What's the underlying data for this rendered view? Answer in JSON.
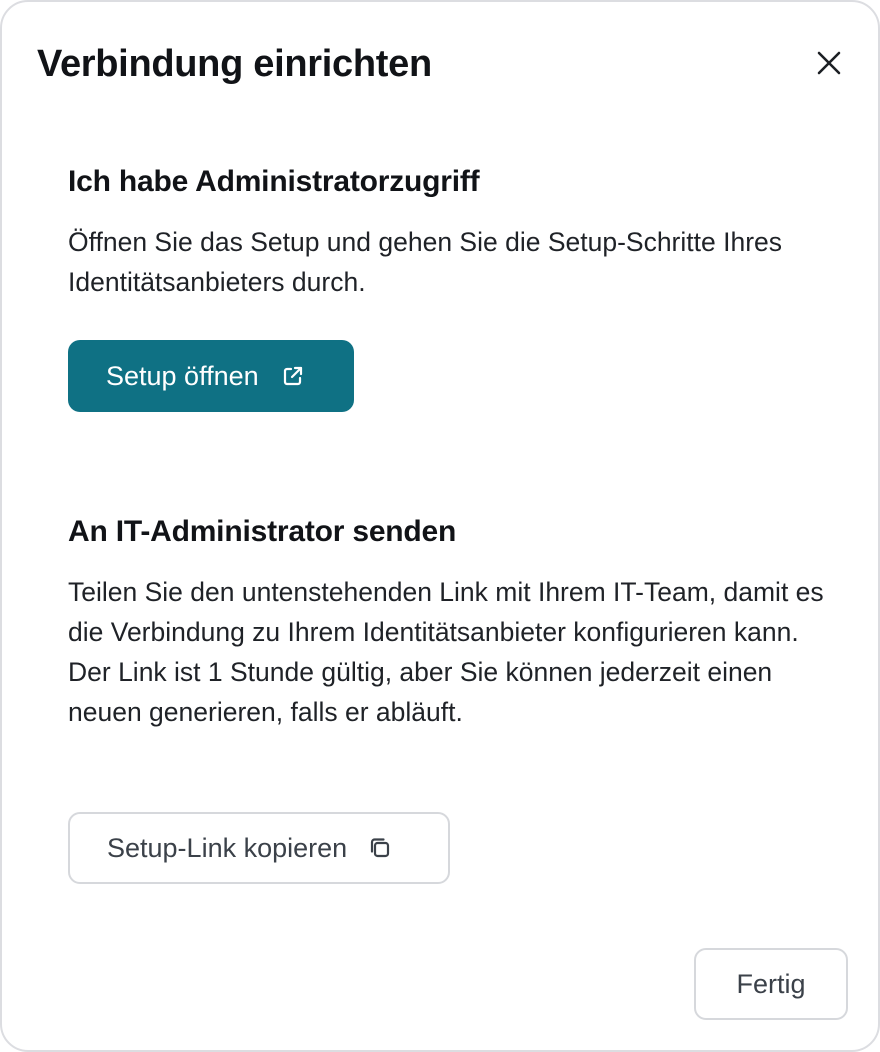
{
  "dialog": {
    "title": "Verbindung einrichten",
    "close_icon": "close-icon"
  },
  "admin_section": {
    "heading": "Ich habe Administratorzugriff",
    "description": "Öffnen Sie das Setup und gehen Sie die Setup-Schritte Ihres Identitätsanbieters durch.",
    "button_label": "Setup öffnen",
    "button_icon": "external-link-icon",
    "button_color": "#0f7184"
  },
  "it_section": {
    "heading": "An IT-Administrator senden",
    "description": "Teilen Sie den untenstehenden Link mit Ihrem IT-Team, damit es die Verbindung zu Ihrem Identitätsanbieter konfigurieren kann. Der Link ist 1 Stunde gültig, aber Sie können jederzeit einen neuen generieren, falls er abläuft.",
    "button_label": "Setup-Link kopieren",
    "button_icon": "copy-icon"
  },
  "footer": {
    "done_label": "Fertig"
  }
}
